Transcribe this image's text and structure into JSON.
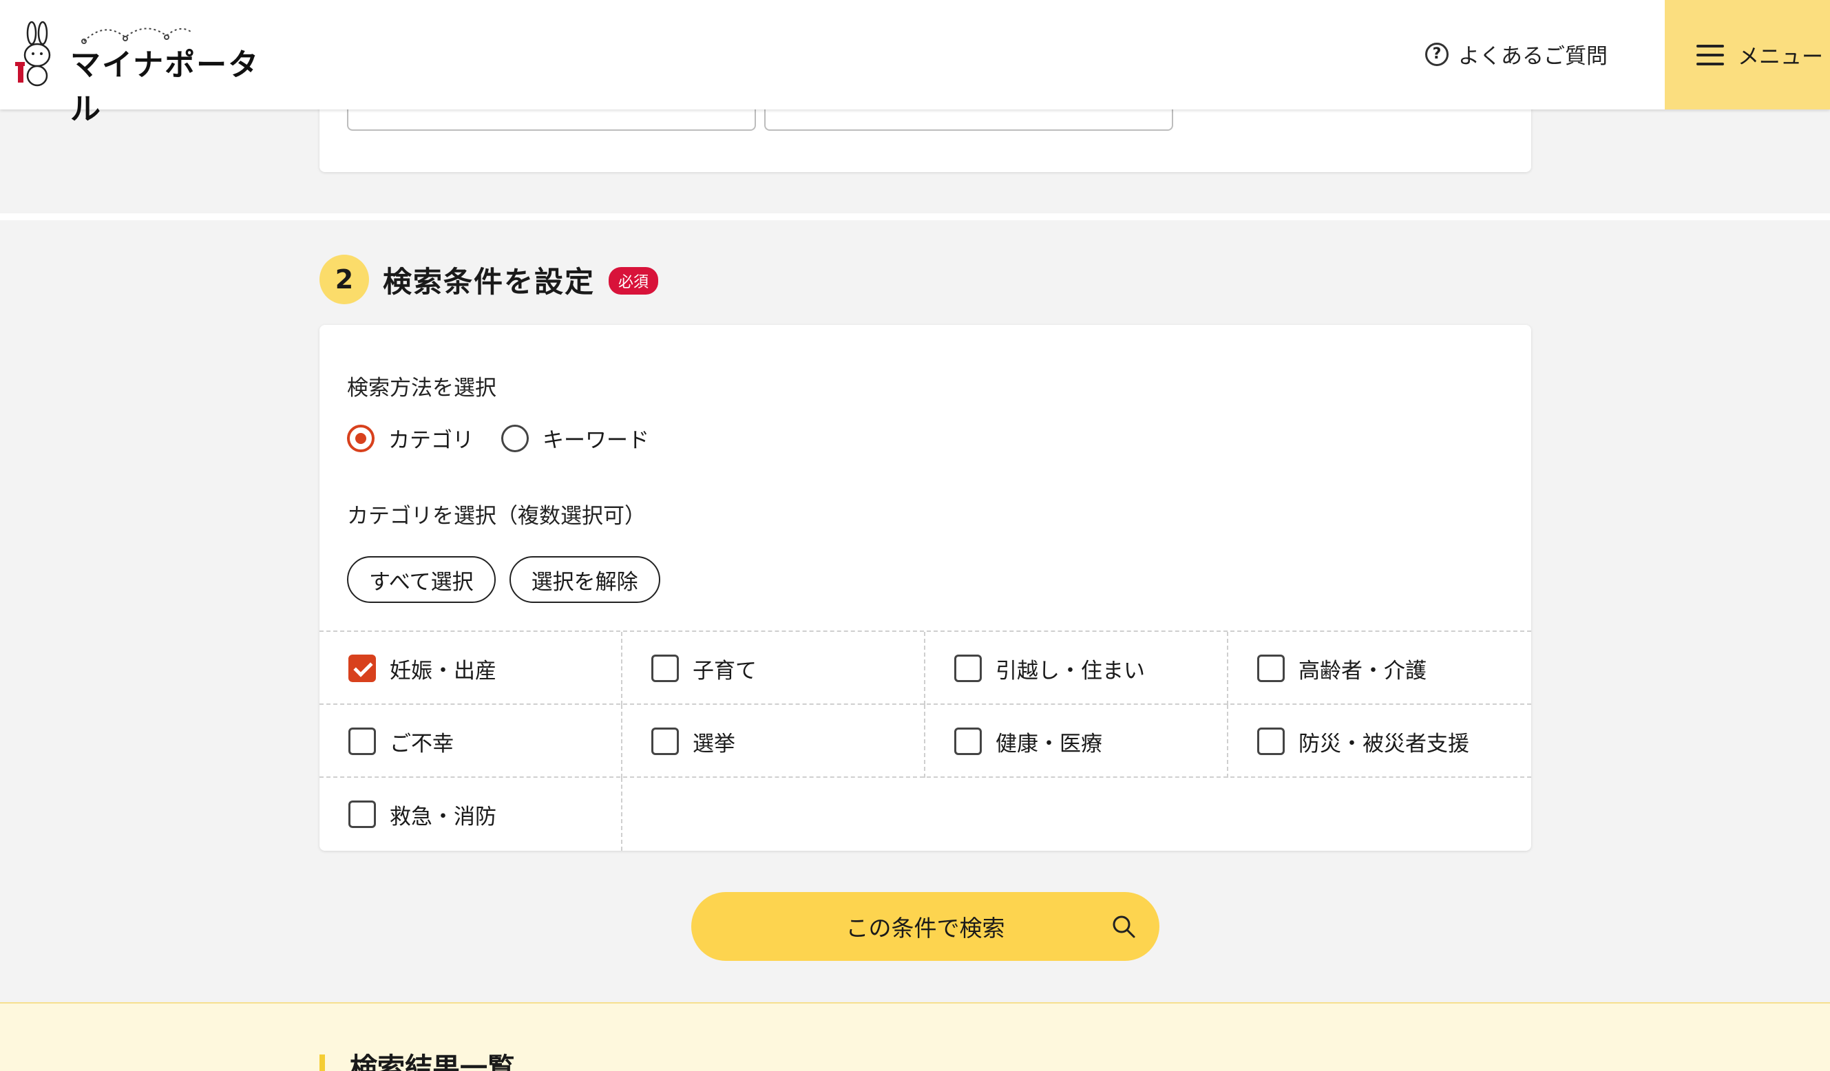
{
  "header": {
    "logo_text": "マイナポータル",
    "faq_label": "よくあるご質問",
    "menu_label": "メニュー"
  },
  "section": {
    "step_number": "2",
    "title": "検索条件を設定",
    "required_badge": "必須"
  },
  "search_method": {
    "label": "検索方法を選択",
    "options": [
      {
        "label": "カテゴリ",
        "selected": true
      },
      {
        "label": "キーワード",
        "selected": false
      }
    ]
  },
  "category": {
    "label": "カテゴリを選択（複数選択可）",
    "select_all_label": "すべて選択",
    "clear_label": "選択を解除",
    "items": [
      {
        "label": "妊娠・出産",
        "checked": true
      },
      {
        "label": "子育て",
        "checked": false
      },
      {
        "label": "引越し・住まい",
        "checked": false
      },
      {
        "label": "高齢者・介護",
        "checked": false
      },
      {
        "label": "ご不幸",
        "checked": false
      },
      {
        "label": "選挙",
        "checked": false
      },
      {
        "label": "健康・医療",
        "checked": false
      },
      {
        "label": "防災・被災者支援",
        "checked": false
      },
      {
        "label": "救急・消防",
        "checked": false
      }
    ]
  },
  "search_button": {
    "label": "この条件で検索",
    "icon": "search-icon"
  },
  "results": {
    "title": "検索結果一覧"
  },
  "colors": {
    "accent": "#d8411d",
    "required": "#d8133a",
    "menu_bg": "#fbde7f",
    "search_btn": "#fdd44f",
    "step_circle": "#fbdc6a"
  }
}
